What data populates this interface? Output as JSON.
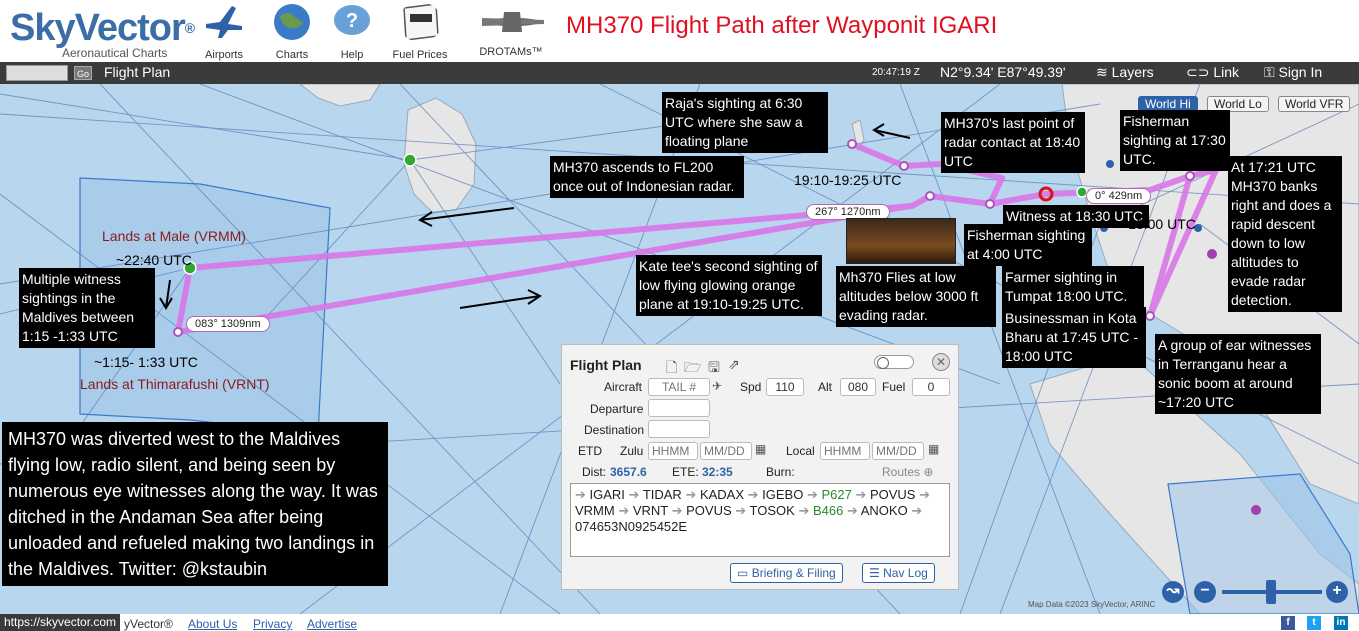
{
  "header": {
    "brand": "SkyVector",
    "brand_mark": "®",
    "tagline": "Aeronautical Charts",
    "title": "MH370 Flight Path after Wayponit IGARI",
    "nav": [
      {
        "label": "Airports",
        "icon": "airport-icon"
      },
      {
        "label": "Charts",
        "icon": "globe-icon"
      },
      {
        "label": "Help",
        "icon": "help-bubble-icon"
      },
      {
        "label": "Fuel Prices",
        "icon": "fuel-sign-icon"
      },
      {
        "label": "DROTAMs™",
        "icon": "drone-icon"
      }
    ]
  },
  "toolbar": {
    "go_label": "Go",
    "flight_plan_label": "Flight Plan",
    "time": "20:47:19 Z",
    "coords": "N2°9.34' E87°49.39'",
    "layers_label": "Layers",
    "link_label": "Link",
    "signin_label": "Sign In"
  },
  "map_buttons": {
    "world_hi": "World Hi",
    "world_lo": "World Lo",
    "world_vfr": "World VFR"
  },
  "annotations": {
    "raja": "Raja's sighting at 6:30 UTC where she saw a floating plane",
    "last_radar": "MH370's last point of radar contact at 18:40 UTC",
    "fisherman_1730": "Fisherman sighting at 17:30 UTC.",
    "ascends": "MH370 ascends to FL200 once out of Indonesian radar.",
    "banks": "At 17:21 UTC MH370 banks right and does a rapid descent down to low altitudes to evade radar detection.",
    "witness_1830": "Witness at 18:30 UTC",
    "fisherman_400": "Fisherman sighting at 4:00 UTC",
    "kate": "Kate tee's second sighting of low flying glowing orange plane at 19:10-19:25 UTC.",
    "flies_low": "Mh370 Flies at low altitudes below 3000 ft evading radar.",
    "farmer": "Farmer sighting in Tumpat 18:00 UTC.",
    "businessman": "Businessman in Kota Bharu at 17:45 UTC - 18:00 UTC",
    "ear_witnesses": "A group of ear witnesses in Terranganu hear a sonic boom at around ~17:20 UTC",
    "maldives_witness": "Multiple witness sightings in the Maldives between 1:15 -1:33 UTC",
    "summary": "MH370 was diverted west to the Maldives flying low, radio silent, and being seen by numerous eye witnesses along the way. It was ditched in the Andaman Sea after being unloaded and refueled making two landings in the Maldives. Twitter: @kstaubin"
  },
  "map_labels": {
    "lands_male": "Lands at Male (VRMM)",
    "time_2240": "~22:40 UTC",
    "time_115": "~1:15- 1:33 UTC",
    "lands_thimarafushi": "Lands at Thimarafushi (VRNT)",
    "time_1910": "19:10-19:25 UTC",
    "time_1800": "~18:00 UTC",
    "attribution": "Map Data ©2023 SkyVector, ARINC"
  },
  "legs": {
    "leg1": "267° 1270nm",
    "leg2": "083° 1309nm",
    "leg3": "0° 429nm"
  },
  "flight_plan": {
    "title": "Flight Plan",
    "aircraft_label": "Aircraft",
    "tail_placeholder": "TAIL #",
    "spd_label": "Spd",
    "spd_value": "110",
    "alt_label": "Alt",
    "alt_value": "080",
    "fuel_label": "Fuel",
    "fuel_value": "0",
    "departure_label": "Departure",
    "destination_label": "Destination",
    "etd_label": "ETD",
    "zulu_label": "Zulu",
    "local_label": "Local",
    "hhmm_placeholder": "HHMM",
    "mmdd_placeholder": "MM/DD",
    "dist_label": "Dist:",
    "dist_value": "3657.6",
    "ete_label": "ETE:",
    "ete_value": "32:35",
    "burn_label": "Burn:",
    "routes_label": "Routes",
    "route": [
      {
        "t": "IGARI",
        "aw": false
      },
      {
        "t": "TIDAR",
        "aw": false
      },
      {
        "t": "KADAX",
        "aw": false
      },
      {
        "t": "IGEBO",
        "aw": false
      },
      {
        "t": "P627",
        "aw": true
      },
      {
        "t": "POVUS",
        "aw": false
      },
      {
        "t": "VRMM",
        "aw": false
      },
      {
        "t": "VRNT",
        "aw": false
      },
      {
        "t": "POVUS",
        "aw": false
      },
      {
        "t": "TOSOK",
        "aw": false
      },
      {
        "t": "B466",
        "aw": true
      },
      {
        "t": "ANOKO",
        "aw": false
      },
      {
        "t": "074653N0925452E",
        "aw": false
      }
    ],
    "briefing_label": "Briefing & Filing",
    "navlog_label": "Nav Log"
  },
  "footer": {
    "url": "https://skyvector.com",
    "copyright": "yVector®",
    "about": "About Us",
    "privacy": "Privacy",
    "advertise": "Advertise"
  },
  "colors": {
    "route": "#d977e8",
    "water": "#b8d6ee",
    "land": "#e6e6e6",
    "fir": "#9ec4ea"
  }
}
